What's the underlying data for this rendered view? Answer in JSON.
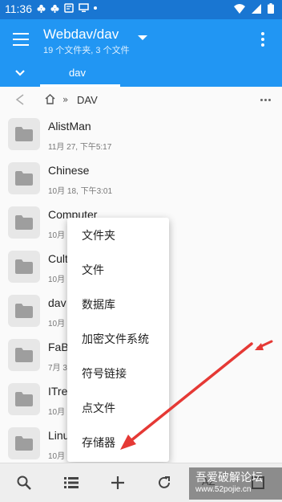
{
  "status_bar": {
    "time": "11:36"
  },
  "app_bar": {
    "title": "Webdav/dav",
    "subtitle": "19 个文件夹, 3 个文件"
  },
  "tabs": [
    {
      "label": "dav"
    }
  ],
  "breadcrumb": {
    "segment": "DAV"
  },
  "files": [
    {
      "name": "AlistMan",
      "meta": "11月 27, 下午5:17"
    },
    {
      "name": "Chinese",
      "meta": "10月 18, 下午3:01"
    },
    {
      "name": "Computer",
      "meta": "10月"
    },
    {
      "name": "Cult",
      "meta": "10月"
    },
    {
      "name": "dav",
      "meta": "10月"
    },
    {
      "name": "FaB",
      "meta": "7月 3"
    },
    {
      "name": "ITre",
      "meta": "10月"
    },
    {
      "name": "Linu",
      "meta": "10月"
    }
  ],
  "menu": {
    "items": [
      {
        "label": "文件夹"
      },
      {
        "label": "文件"
      },
      {
        "label": "数据库"
      },
      {
        "label": "加密文件系统"
      },
      {
        "label": "符号链接"
      },
      {
        "label": "点文件"
      },
      {
        "label": "存储器"
      }
    ]
  },
  "bottom_bar": {
    "icons": [
      "search-icon",
      "list-view-icon",
      "add-icon",
      "refresh-icon",
      "sort-az-icon",
      "select-icon"
    ],
    "sort_label": "AZ"
  },
  "watermark": {
    "title": "吾爱破解论坛",
    "url": "www.52pojie.cn"
  },
  "colors": {
    "primary": "#2196f3",
    "primary_dark": "#1976d2",
    "arrow": "#e53935"
  }
}
